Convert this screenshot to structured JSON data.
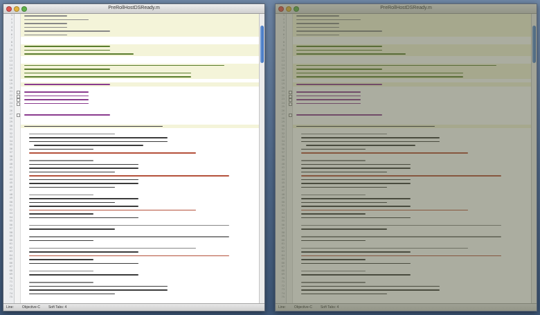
{
  "windows": [
    {
      "id": "left",
      "title": "PreRollHostDSReady.m",
      "focused": true,
      "first_line": 1,
      "scroll": {
        "position": 0.04,
        "visible": 0.13
      },
      "status": {
        "line": "Line:",
        "language": "Objective-C",
        "tab": "Soft Tabs: 4"
      }
    },
    {
      "id": "right",
      "title": "PreRollHostDSReady.m",
      "focused": false,
      "first_line": 1,
      "scroll": {
        "position": 0.04,
        "visible": 0.13
      },
      "status": {
        "line": "Line:",
        "language": "Objective-C",
        "tab": "Soft Tabs: 4"
      }
    }
  ],
  "colors": {
    "comment": "#878787",
    "preprocessor": "#5a7d2c",
    "keyword": "#8a3a8e",
    "string": "#b4503a",
    "plain": "#3a3a3a",
    "highlight_band": "#f4f4d9",
    "desktop": "#4f6889"
  },
  "icons": {
    "close": "close-dot-icon",
    "minimize": "minimize-dot-icon",
    "zoom": "zoom-dot-icon"
  },
  "code_lines": [
    {
      "k": "comment",
      "w": 0,
      "i": 0,
      "b": 1
    },
    {
      "k": "comment",
      "w": 1,
      "i": 0,
      "b": 1
    },
    {
      "k": "comment",
      "w": 0,
      "i": 0,
      "b": 1
    },
    {
      "k": "comment",
      "w": 0,
      "i": 0,
      "b": 1
    },
    {
      "k": "comment",
      "w": 2,
      "i": 0,
      "b": 1
    },
    {
      "k": "comment",
      "w": 0,
      "i": 0,
      "b": 1
    },
    {
      "k": "empty",
      "w": 0,
      "i": 0,
      "b": 0
    },
    {
      "k": "empty",
      "w": 0,
      "i": 0,
      "b": 0
    },
    {
      "k": "pre",
      "w": 2,
      "i": 0,
      "b": 1
    },
    {
      "k": "pre",
      "w": 2,
      "i": 0,
      "b": 1
    },
    {
      "k": "pre",
      "w": 3,
      "i": 0,
      "b": 1
    },
    {
      "k": "empty",
      "w": 0,
      "i": 0,
      "b": 0
    },
    {
      "k": "empty",
      "w": 0,
      "i": 0,
      "b": 0
    },
    {
      "k": "pre",
      "w": 6,
      "i": 0,
      "b": 1
    },
    {
      "k": "pre",
      "w": 2,
      "i": 0,
      "b": 1
    },
    {
      "k": "pre",
      "w": 5,
      "i": 0,
      "b": 1
    },
    {
      "k": "pre",
      "w": 5,
      "i": 0,
      "b": 1
    },
    {
      "k": "empty",
      "w": 0,
      "i": 0,
      "b": 0
    },
    {
      "k": "keyword",
      "w": 2,
      "i": 0,
      "b": 1
    },
    {
      "k": "empty",
      "w": 0,
      "i": 0,
      "b": 0
    },
    {
      "k": "keyword",
      "w": 1,
      "i": 0,
      "b": 0
    },
    {
      "k": "keyword",
      "w": 1,
      "i": 0,
      "b": 0
    },
    {
      "k": "keyword",
      "w": 1,
      "i": 0,
      "b": 0
    },
    {
      "k": "keyword",
      "w": 1,
      "i": 0,
      "b": 0
    },
    {
      "k": "empty",
      "w": 0,
      "i": 0,
      "b": 0
    },
    {
      "k": "empty",
      "w": 0,
      "i": 0,
      "b": 0
    },
    {
      "k": "keyword",
      "w": 2,
      "i": 0,
      "b": 0
    },
    {
      "k": "empty",
      "w": 0,
      "i": 0,
      "b": 0
    },
    {
      "k": "empty",
      "w": 0,
      "i": 0,
      "b": 0
    },
    {
      "k": "plain",
      "w": 4,
      "i": 0,
      "b": 1
    },
    {
      "k": "empty",
      "w": 0,
      "i": 0,
      "b": 0
    },
    {
      "k": "comment",
      "w": 2,
      "i": 1,
      "b": 0
    },
    {
      "k": "plain",
      "w": 4,
      "i": 1,
      "b": 0
    },
    {
      "k": "plain",
      "w": 4,
      "i": 1,
      "b": 0
    },
    {
      "k": "plain",
      "w": 3,
      "i": 2,
      "b": 0
    },
    {
      "k": "plain",
      "w": 1,
      "i": 1,
      "b": 0
    },
    {
      "k": "string",
      "w": 5,
      "i": 1,
      "b": 0
    },
    {
      "k": "empty",
      "w": 0,
      "i": 0,
      "b": 0
    },
    {
      "k": "comment",
      "w": 1,
      "i": 1,
      "b": 0
    },
    {
      "k": "plain",
      "w": 3,
      "i": 1,
      "b": 0
    },
    {
      "k": "plain",
      "w": 3,
      "i": 1,
      "b": 0
    },
    {
      "k": "plain",
      "w": 2,
      "i": 1,
      "b": 0
    },
    {
      "k": "string",
      "w": 6,
      "i": 1,
      "b": 0
    },
    {
      "k": "plain",
      "w": 3,
      "i": 1,
      "b": 0
    },
    {
      "k": "plain",
      "w": 3,
      "i": 1,
      "b": 0
    },
    {
      "k": "plain",
      "w": 2,
      "i": 1,
      "b": 0
    },
    {
      "k": "empty",
      "w": 0,
      "i": 0,
      "b": 0
    },
    {
      "k": "comment",
      "w": 1,
      "i": 1,
      "b": 0
    },
    {
      "k": "plain",
      "w": 3,
      "i": 1,
      "b": 0
    },
    {
      "k": "plain",
      "w": 2,
      "i": 1,
      "b": 0
    },
    {
      "k": "plain",
      "w": 3,
      "i": 1,
      "b": 0
    },
    {
      "k": "string",
      "w": 5,
      "i": 1,
      "b": 0
    },
    {
      "k": "plain",
      "w": 1,
      "i": 1,
      "b": 0
    },
    {
      "k": "plain",
      "w": 3,
      "i": 1,
      "b": 0
    },
    {
      "k": "empty",
      "w": 0,
      "i": 0,
      "b": 0
    },
    {
      "k": "comment",
      "w": 6,
      "i": 1,
      "b": 0
    },
    {
      "k": "plain",
      "w": 2,
      "i": 1,
      "b": 0
    },
    {
      "k": "empty",
      "w": 0,
      "i": 0,
      "b": 0
    },
    {
      "k": "comment",
      "w": 6,
      "i": 1,
      "b": 0
    },
    {
      "k": "plain",
      "w": 1,
      "i": 1,
      "b": 0
    },
    {
      "k": "empty",
      "w": 0,
      "i": 0,
      "b": 0
    },
    {
      "k": "comment",
      "w": 5,
      "i": 1,
      "b": 0
    },
    {
      "k": "plain",
      "w": 3,
      "i": 1,
      "b": 0
    },
    {
      "k": "string",
      "w": 6,
      "i": 1,
      "b": 0
    },
    {
      "k": "plain",
      "w": 1,
      "i": 1,
      "b": 0
    },
    {
      "k": "plain",
      "w": 3,
      "i": 1,
      "b": 0
    },
    {
      "k": "empty",
      "w": 0,
      "i": 0,
      "b": 0
    },
    {
      "k": "comment",
      "w": 1,
      "i": 1,
      "b": 0
    },
    {
      "k": "plain",
      "w": 3,
      "i": 1,
      "b": 0
    },
    {
      "k": "empty",
      "w": 0,
      "i": 0,
      "b": 0
    },
    {
      "k": "comment",
      "w": 1,
      "i": 1,
      "b": 0
    },
    {
      "k": "plain",
      "w": 4,
      "i": 1,
      "b": 0
    },
    {
      "k": "plain",
      "w": 4,
      "i": 1,
      "b": 0
    },
    {
      "k": "plain",
      "w": 2,
      "i": 1,
      "b": 0
    },
    {
      "k": "empty",
      "w": 0,
      "i": 0,
      "b": 0
    }
  ]
}
